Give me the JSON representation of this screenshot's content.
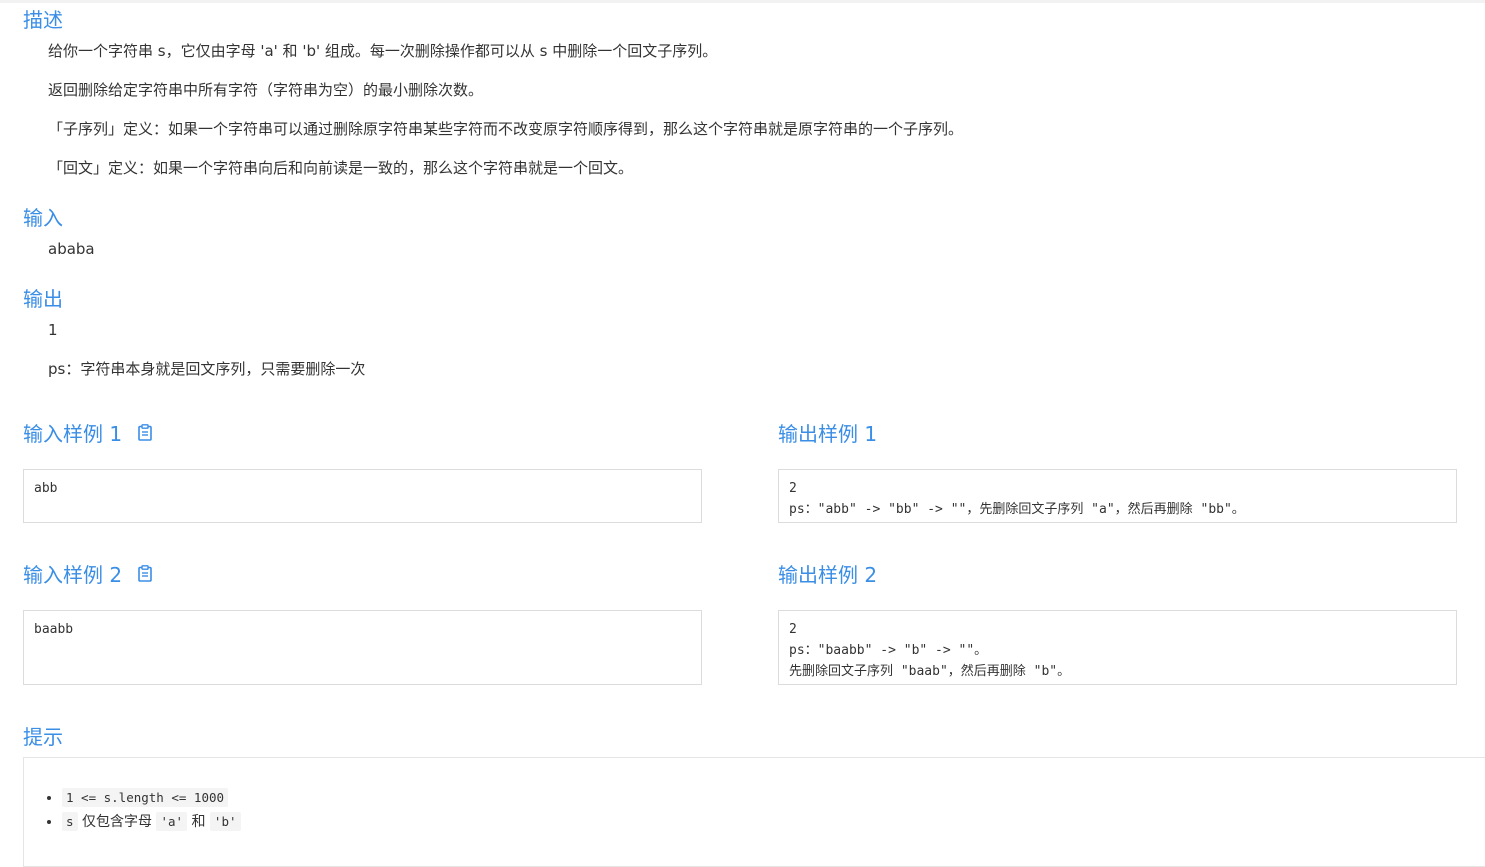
{
  "sections": {
    "description_title": "描述",
    "input_title": "输入",
    "output_title": "输出",
    "hint_title": "提示"
  },
  "description": [
    "给你一个字符串 s，它仅由字母 'a' 和 'b' 组成。每一次删除操作都可以从 s 中删除一个回文子序列。",
    "返回删除给定字符串中所有字符（字符串为空）的最小删除次数。",
    "「子序列」定义：如果一个字符串可以通过删除原字符串某些字符而不改变原字符顺序得到，那么这个字符串就是原字符串的一个子序列。",
    "「回文」定义：如果一个字符串向后和向前读是一致的，那么这个字符串就是一个回文。"
  ],
  "input": {
    "value": "ababa"
  },
  "output": {
    "value": "1",
    "note": "ps：字符串本身就是回文序列，只需要删除一次"
  },
  "samples": [
    {
      "input_title": "输入样例 1",
      "output_title": "输出样例 1",
      "input": "abb",
      "output": "2\nps：\"abb\" -> \"bb\" -> \"\"，先删除回文子序列 \"a\"，然后再删除 \"bb\"。"
    },
    {
      "input_title": "输入样例 2",
      "output_title": "输出样例 2",
      "input": "baabb",
      "output": "2\nps：\"baabb\" -> \"b\" -> \"\"。\n先删除回文子序列 \"baab\"，然后再删除 \"b\"。"
    }
  ],
  "hints": {
    "item1_code": "1 <= s.length <= 1000",
    "item2_code_s": "s",
    "item2_text1": "仅包含字母",
    "item2_code_a": "'a'",
    "item2_text2": "和",
    "item2_code_b": "'b'"
  },
  "icons": {
    "copy": "clipboard-icon"
  },
  "colors": {
    "heading": "#3a8ee6",
    "text": "#333333",
    "border": "#dcdcdc",
    "code_bg": "#f4f4f4"
  }
}
